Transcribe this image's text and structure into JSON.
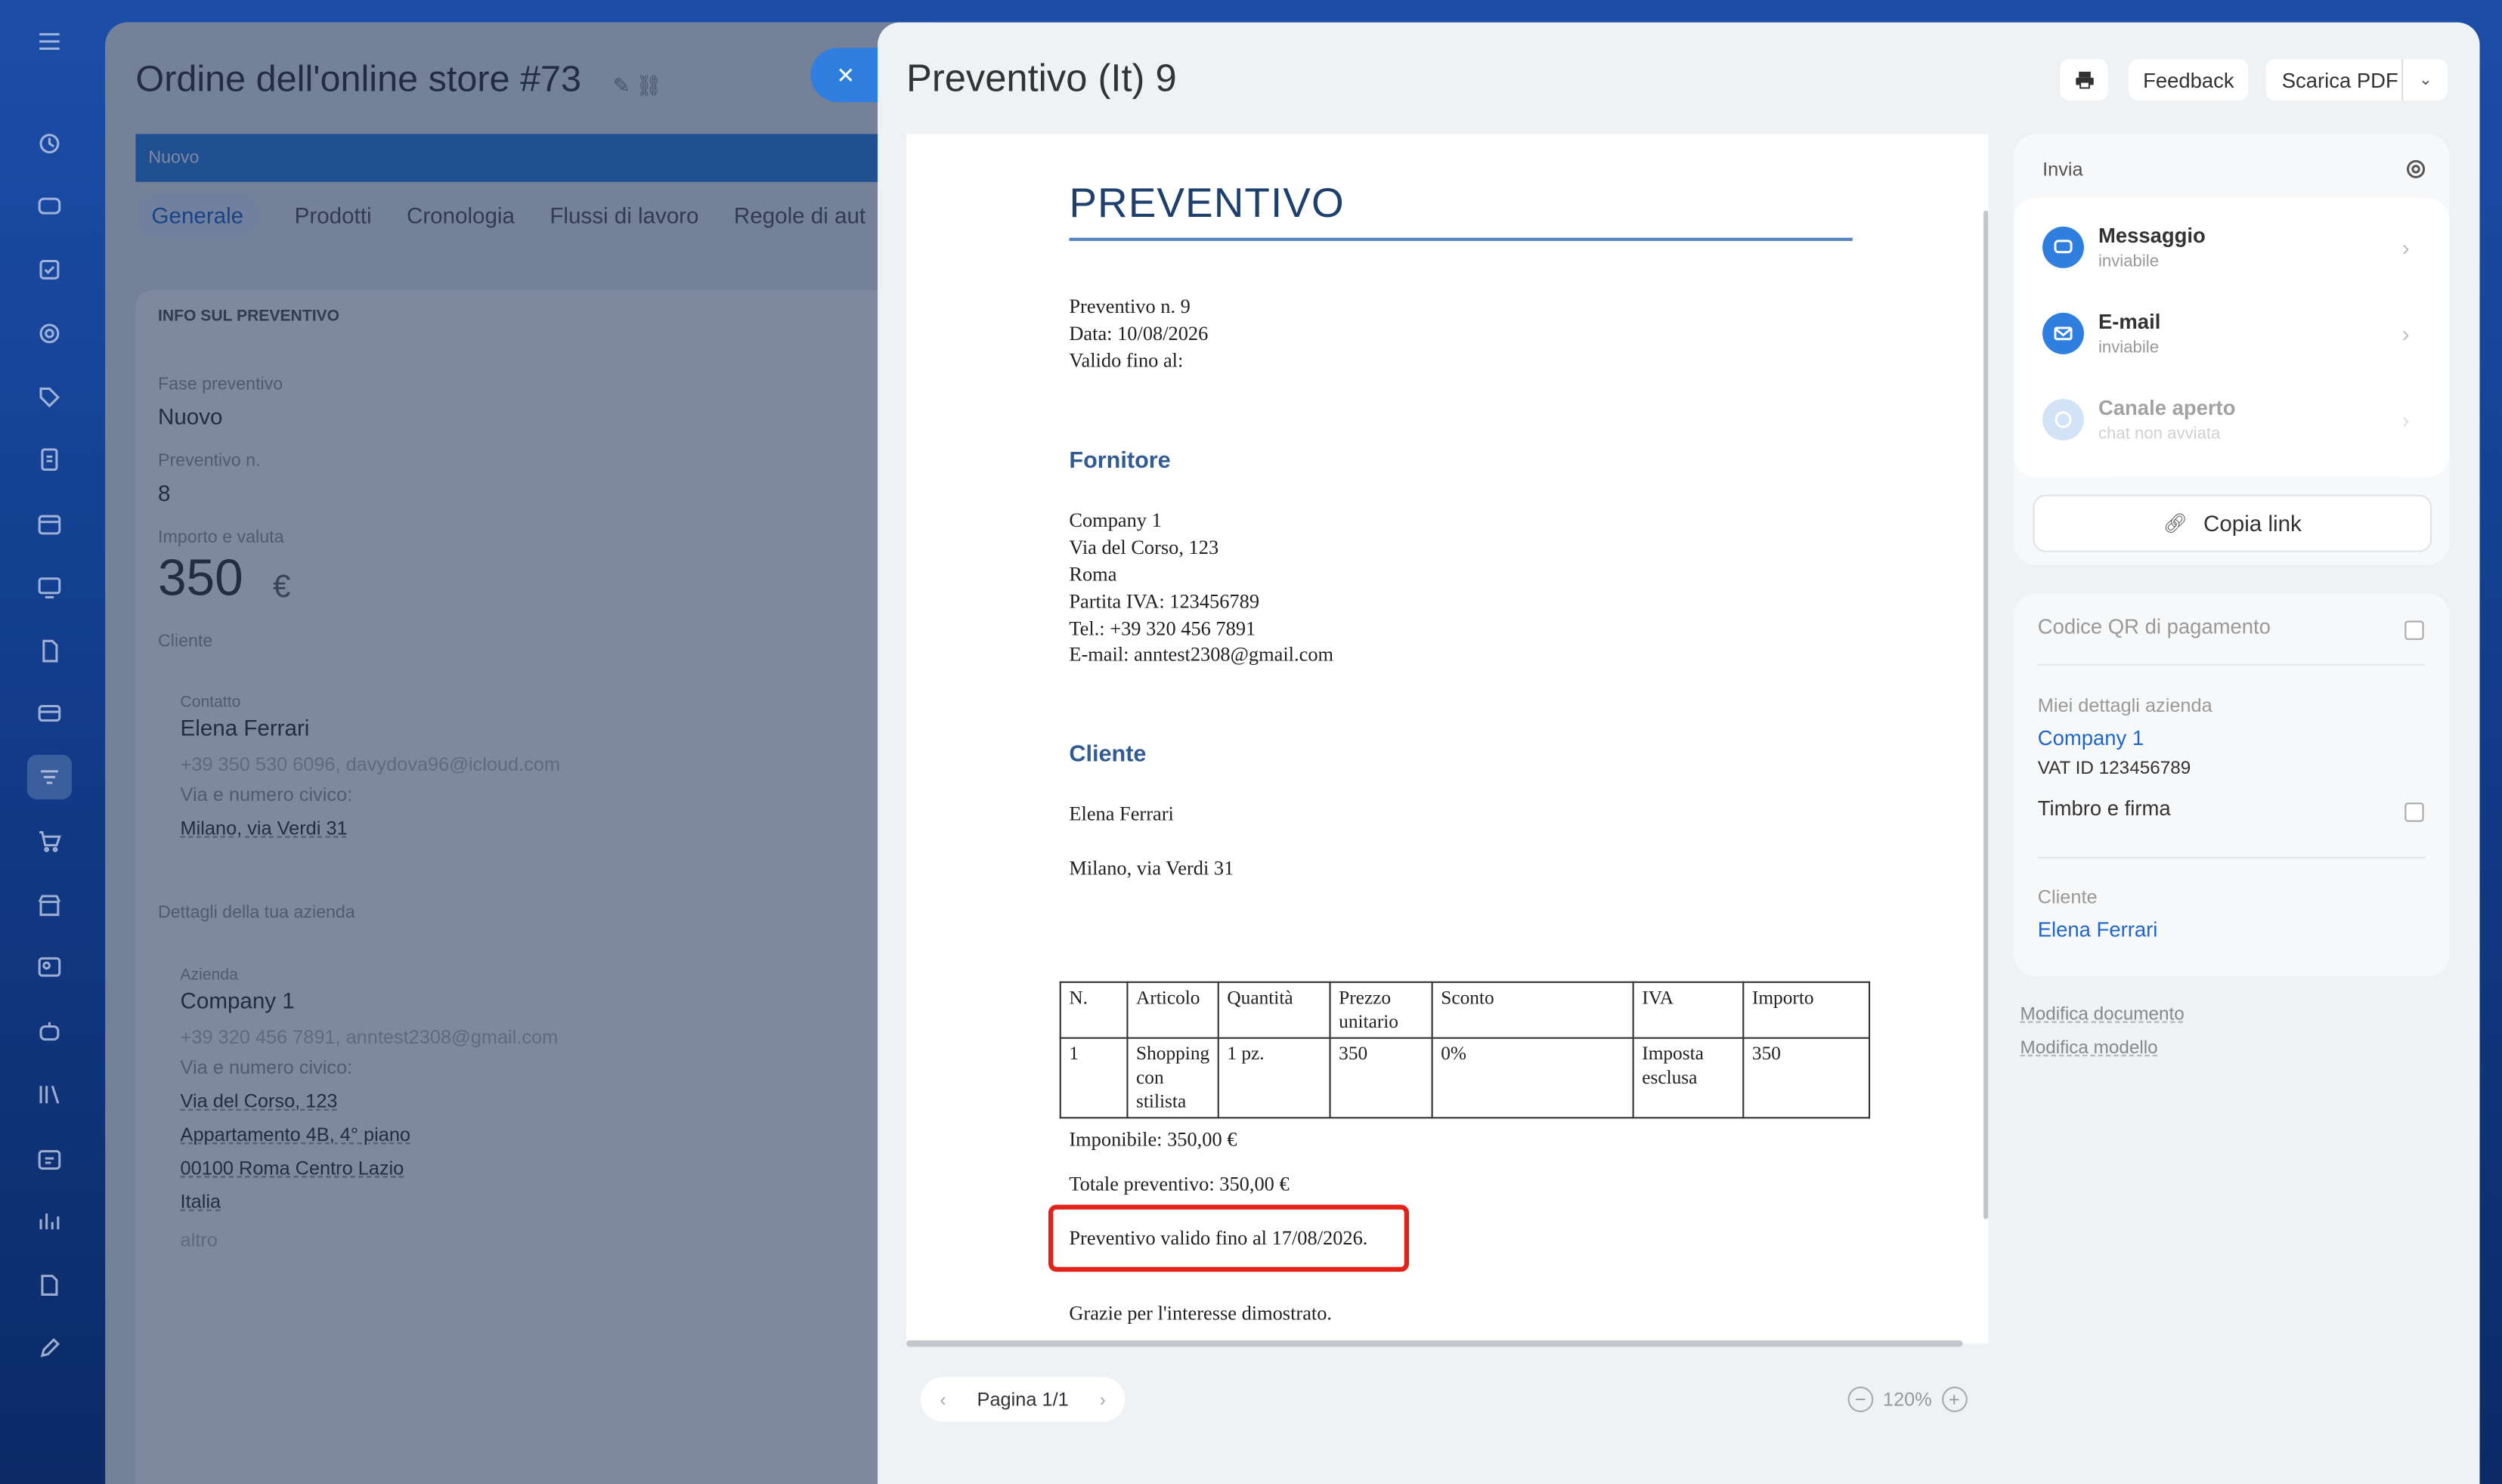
{
  "order": {
    "title": "Ordine dell'online store #73",
    "stage_bar": "Nuovo",
    "tabs": [
      "Generale",
      "Prodotti",
      "Cronologia",
      "Flussi di lavoro",
      "Regole di aut"
    ],
    "section_title": "INFO SUL PREVENTIVO",
    "fase_label": "Fase preventivo",
    "fase_value": "Nuovo",
    "num_label": "Preventivo n.",
    "num_value": "8",
    "amount_label": "Importo e valuta",
    "amount_value": "350",
    "amount_currency": "€",
    "client_label": "Cliente",
    "contact_label": "Contatto",
    "contact_name": "Elena Ferrari",
    "contact_info": "+39 350 530 6096, davydova96@icloud.com",
    "address_label": "Via e numero civico:",
    "contact_address": "Milano, via Verdi 31",
    "company_section": "Dettagli della tua azienda",
    "company_label": "Azienda",
    "company_name": "Company 1",
    "company_info": "+39 320 456 7891, anntest2308@gmail.com",
    "company_address_label": "Via e numero civico:",
    "company_address": [
      "Via del Corso, 123",
      "Appartamento 4B, 4° piano",
      "00100 Roma Centro Lazio",
      "Italia"
    ],
    "more": "altro"
  },
  "panel": {
    "title": "Preventivo (It) 9",
    "feedback": "Feedback",
    "download": "Scarica PDF"
  },
  "document": {
    "heading": "PREVENTIVO",
    "meta": [
      "Preventivo n. 9",
      "Data: 10/08/2026",
      "Valido fino al:"
    ],
    "supplier_heading": "Fornitore",
    "supplier": [
      "Company 1",
      "Via del Corso, 123",
      "Roma",
      "Partita IVA: 123456789",
      "Tel.: +39 320 456 7891",
      "E-mail: anntest2308@gmail.com"
    ],
    "client_heading": "Cliente",
    "client_name": "Elena Ferrari",
    "client_address": "Milano, via Verdi 31",
    "table_headers": [
      "N.",
      "Articolo",
      "Quantità",
      "Prezzo unitario",
      "Sconto",
      "IVA",
      "Importo"
    ],
    "table_row": [
      "1",
      "Shopping con stilista",
      "1 pz.",
      "350",
      "0%",
      "Imposta esclusa",
      "350"
    ],
    "subtotal": "Imponibile: 350,00 €",
    "total": "Totale preventivo: 350,00 €",
    "validity": "Preventivo valido fino al 17/08/2026.",
    "thanks": "Grazie per l'interesse dimostrato."
  },
  "pager": {
    "label": "Pagina 1/1",
    "zoom": "120%"
  },
  "send": {
    "header": "Invia",
    "channels": [
      {
        "name": "Messaggio",
        "status": "inviabile"
      },
      {
        "name": "E-mail",
        "status": "inviabile"
      },
      {
        "name": "Canale aperto",
        "status": "chat non avviata"
      }
    ],
    "copy_link": "Copia link"
  },
  "details": {
    "qr_label": "Codice QR di pagamento",
    "company_details_label": "Miei dettagli azienda",
    "company_name": "Company 1",
    "vat": "VAT ID 123456789",
    "stamp_label": "Timbro e firma",
    "client_label": "Cliente",
    "client_name": "Elena Ferrari"
  },
  "links": {
    "edit_document": "Modifica documento",
    "edit_template": "Modifica modello"
  },
  "colors": {
    "accent": "#2f7fe0",
    "highlight": "#e2231a",
    "doc_heading": "#1f3f6d"
  }
}
